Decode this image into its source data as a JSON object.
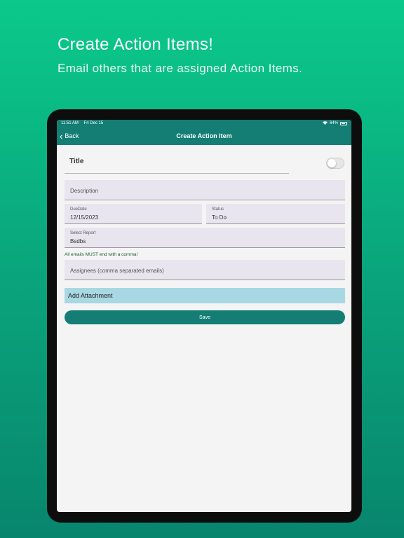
{
  "promo": {
    "headline": "Create Action Items!",
    "subline": "Email others that are assigned Action Items."
  },
  "status_bar": {
    "time": "11:51 AM",
    "date": "Fri Dec 15",
    "battery": "64%"
  },
  "nav": {
    "back_label": "Back",
    "title": "Create Action Item"
  },
  "form": {
    "title_label": "Title",
    "toggle_on": false,
    "description_placeholder": "Description",
    "due_date_label": "DueDate",
    "due_date_value": "12/15/2023",
    "status_label": "Status",
    "status_value": "To Do",
    "report_label": "Select Report",
    "report_value": "Bsdbs",
    "email_note": "All emails MUST end with a comma!",
    "assignees_placeholder": "Assignees (comma separated emails)",
    "attachment_button": "Add Attachment",
    "save_button": "Save"
  },
  "colors": {
    "accent": "#147e75",
    "field_bg": "#e9e5ef",
    "attachment_bg": "#a8d8e4",
    "background_top": "#0bc98a"
  }
}
